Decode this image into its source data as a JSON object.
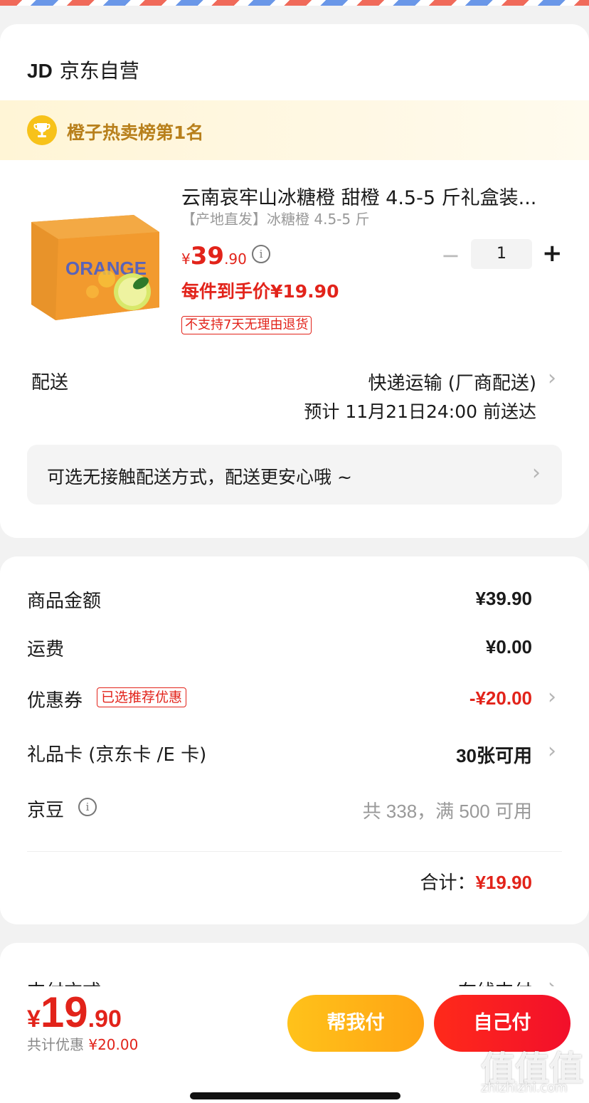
{
  "store": {
    "logo": "JD",
    "name": "京东自营"
  },
  "rank_banner": {
    "icon": "trophy-icon",
    "text": "橙子热卖榜第1名"
  },
  "product": {
    "image_label": "ORANGE",
    "title": "云南哀牢山冰糖橙 甜橙 4.5-5 斤礼盒装...",
    "subtitle": "【产地直发】冰糖橙 4.5-5 斤",
    "price_yen": "¥",
    "price_int": "39",
    "price_dec": ".90",
    "quantity": "1",
    "minus": "−",
    "plus": "+",
    "unit_price": "每件到手价¥19.90",
    "return_tag": "不支持7天无理由退货"
  },
  "delivery": {
    "label": "配送",
    "method": "快递运输 (厂商配送)",
    "eta": "预计 11月21日24:00 前送达",
    "no_contact": "可选无接触配送方式，配送更安心哦 ~"
  },
  "fees": {
    "goods_label": "商品金额",
    "goods_value": "¥39.90",
    "shipping_label": "运费",
    "shipping_value": "¥0.00",
    "coupon_label": "优惠券",
    "coupon_tag": "已选推荐优惠",
    "coupon_value": "-¥20.00",
    "giftcard_label": "礼品卡 (京东卡 /E 卡)",
    "giftcard_value": "30张可用",
    "beans_label": "京豆",
    "beans_value": "共 338，满 500 可用",
    "total_label": "合计：",
    "total_value": "¥19.90"
  },
  "payment": {
    "label": "支付方式",
    "value": "在线支付"
  },
  "checkout": {
    "yen": "¥",
    "int": "19",
    "dec": ".90",
    "saving_label": "共计优惠 ",
    "saving_value": "¥20.00",
    "help_pay": "帮我付",
    "self_pay": "自己付"
  },
  "chevron": "›",
  "watermark": {
    "logo": "值值值",
    "url": "zhizhizhi.com"
  },
  "colors": {
    "accent": "#e2231a",
    "gold": "#f7c21a",
    "rank_text": "#b8801c"
  }
}
